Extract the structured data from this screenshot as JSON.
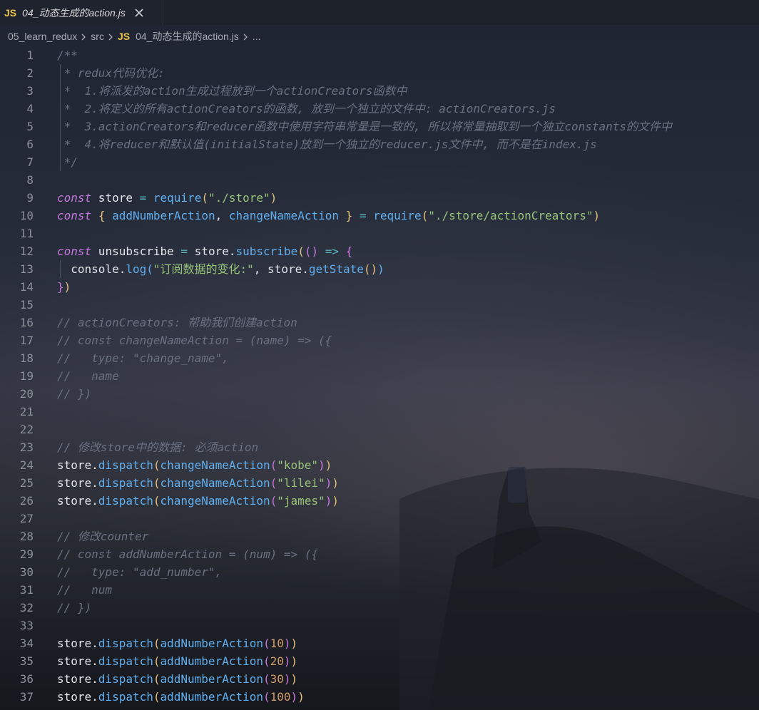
{
  "tab": {
    "badge": "JS",
    "title": "04_动态生成的action.js",
    "close_icon": "close-icon"
  },
  "breadcrumb": {
    "items": [
      "05_learn_redux",
      "src"
    ],
    "file_badge": "JS",
    "file": "04_动态生成的action.js",
    "more": "..."
  },
  "colors": {
    "keyword": "#c678dd",
    "function": "#61afef",
    "string": "#98c379",
    "number": "#d19a66",
    "comment": "#6a7080",
    "bracket_gold": "#e5c07b",
    "js_badge": "#e8c24a"
  },
  "lines": [
    {
      "n": "1",
      "tokens": [
        [
          "com",
          "/**"
        ]
      ]
    },
    {
      "n": "2",
      "tokens": [
        [
          "com",
          " * redux代码优化:"
        ]
      ]
    },
    {
      "n": "3",
      "tokens": [
        [
          "com",
          " *  1.将派发的action生成过程放到一个actionCreators函数中"
        ]
      ]
    },
    {
      "n": "4",
      "tokens": [
        [
          "com",
          " *  2.将定义的所有actionCreators的函数, 放到一个独立的文件中: actionCreators.js"
        ]
      ]
    },
    {
      "n": "5",
      "tokens": [
        [
          "com",
          " *  3.actionCreators和reducer函数中使用字符串常量是一致的, 所以将常量抽取到一个独立constants的文件中"
        ]
      ]
    },
    {
      "n": "6",
      "tokens": [
        [
          "com",
          " *  4.将reducer和默认值(initialState)放到一个独立的reducer.js文件中, 而不是在index.js"
        ]
      ]
    },
    {
      "n": "7",
      "tokens": [
        [
          "com",
          " */"
        ]
      ]
    },
    {
      "n": "8",
      "tokens": []
    },
    {
      "n": "9",
      "tokens": [
        [
          "kw",
          "const"
        ],
        [
          "var",
          " store "
        ],
        [
          "op",
          "="
        ],
        [
          "plain",
          " "
        ],
        [
          "fn",
          "require"
        ],
        [
          "p1",
          "("
        ],
        [
          "str",
          "\"./store\""
        ],
        [
          "p1",
          ")"
        ]
      ]
    },
    {
      "n": "10",
      "tokens": [
        [
          "kw",
          "const"
        ],
        [
          "plain",
          " "
        ],
        [
          "p1",
          "{"
        ],
        [
          "plain",
          " "
        ],
        [
          "fn",
          "addNumberAction"
        ],
        [
          "plain",
          ", "
        ],
        [
          "fn",
          "changeNameAction"
        ],
        [
          "plain",
          " "
        ],
        [
          "p1",
          "}"
        ],
        [
          "plain",
          " "
        ],
        [
          "op",
          "="
        ],
        [
          "plain",
          " "
        ],
        [
          "fn",
          "require"
        ],
        [
          "p1",
          "("
        ],
        [
          "str",
          "\"./store/actionCreators\""
        ],
        [
          "p1",
          ")"
        ]
      ]
    },
    {
      "n": "11",
      "tokens": []
    },
    {
      "n": "12",
      "tokens": [
        [
          "kw",
          "const"
        ],
        [
          "var",
          " unsubscribe "
        ],
        [
          "op",
          "="
        ],
        [
          "plain",
          " store."
        ],
        [
          "fn",
          "subscribe"
        ],
        [
          "p1",
          "("
        ],
        [
          "p2",
          "()"
        ],
        [
          "plain",
          " "
        ],
        [
          "op",
          "=>"
        ],
        [
          "plain",
          " "
        ],
        [
          "p2",
          "{"
        ]
      ]
    },
    {
      "n": "13",
      "tokens": [
        [
          "plain",
          "  console."
        ],
        [
          "fn",
          "log"
        ],
        [
          "p3",
          "("
        ],
        [
          "str",
          "\"订阅数据的变化:\""
        ],
        [
          "plain",
          ", store."
        ],
        [
          "fn",
          "getState"
        ],
        [
          "p1",
          "()"
        ],
        [
          "p3",
          ")"
        ]
      ]
    },
    {
      "n": "14",
      "tokens": [
        [
          "p2",
          "}"
        ],
        [
          "p1",
          ")"
        ]
      ]
    },
    {
      "n": "15",
      "tokens": []
    },
    {
      "n": "16",
      "tokens": [
        [
          "com",
          "// actionCreators: 帮助我们创建action"
        ]
      ]
    },
    {
      "n": "17",
      "tokens": [
        [
          "com",
          "// const changeNameAction = (name) => ({"
        ]
      ]
    },
    {
      "n": "18",
      "tokens": [
        [
          "com",
          "//   type: \"change_name\","
        ]
      ]
    },
    {
      "n": "19",
      "tokens": [
        [
          "com",
          "//   name"
        ]
      ]
    },
    {
      "n": "20",
      "tokens": [
        [
          "com",
          "// })"
        ]
      ]
    },
    {
      "n": "21",
      "tokens": []
    },
    {
      "n": "22",
      "tokens": []
    },
    {
      "n": "23",
      "tokens": [
        [
          "com",
          "// 修改store中的数据: 必须action"
        ]
      ]
    },
    {
      "n": "24",
      "tokens": [
        [
          "plain",
          "store."
        ],
        [
          "fn",
          "dispatch"
        ],
        [
          "p1",
          "("
        ],
        [
          "fn",
          "changeNameAction"
        ],
        [
          "p2",
          "("
        ],
        [
          "str",
          "\"kobe\""
        ],
        [
          "p2",
          ")"
        ],
        [
          "p1",
          ")"
        ]
      ]
    },
    {
      "n": "25",
      "tokens": [
        [
          "plain",
          "store."
        ],
        [
          "fn",
          "dispatch"
        ],
        [
          "p1",
          "("
        ],
        [
          "fn",
          "changeNameAction"
        ],
        [
          "p2",
          "("
        ],
        [
          "str",
          "\"lilei\""
        ],
        [
          "p2",
          ")"
        ],
        [
          "p1",
          ")"
        ]
      ]
    },
    {
      "n": "26",
      "tokens": [
        [
          "plain",
          "store."
        ],
        [
          "fn",
          "dispatch"
        ],
        [
          "p1",
          "("
        ],
        [
          "fn",
          "changeNameAction"
        ],
        [
          "p2",
          "("
        ],
        [
          "str",
          "\"james\""
        ],
        [
          "p2",
          ")"
        ],
        [
          "p1",
          ")"
        ]
      ]
    },
    {
      "n": "27",
      "tokens": []
    },
    {
      "n": "28",
      "tokens": [
        [
          "com",
          "// 修改counter"
        ]
      ]
    },
    {
      "n": "29",
      "tokens": [
        [
          "com",
          "// const addNumberAction = (num) => ({"
        ]
      ]
    },
    {
      "n": "30",
      "tokens": [
        [
          "com",
          "//   type: \"add_number\","
        ]
      ]
    },
    {
      "n": "31",
      "tokens": [
        [
          "com",
          "//   num"
        ]
      ]
    },
    {
      "n": "32",
      "tokens": [
        [
          "com",
          "// })"
        ]
      ]
    },
    {
      "n": "33",
      "tokens": []
    },
    {
      "n": "34",
      "tokens": [
        [
          "plain",
          "store."
        ],
        [
          "fn",
          "dispatch"
        ],
        [
          "p1",
          "("
        ],
        [
          "fn",
          "addNumberAction"
        ],
        [
          "p2",
          "("
        ],
        [
          "num",
          "10"
        ],
        [
          "p2",
          ")"
        ],
        [
          "p1",
          ")"
        ]
      ]
    },
    {
      "n": "35",
      "tokens": [
        [
          "plain",
          "store."
        ],
        [
          "fn",
          "dispatch"
        ],
        [
          "p1",
          "("
        ],
        [
          "fn",
          "addNumberAction"
        ],
        [
          "p2",
          "("
        ],
        [
          "num",
          "20"
        ],
        [
          "p2",
          ")"
        ],
        [
          "p1",
          ")"
        ]
      ]
    },
    {
      "n": "36",
      "tokens": [
        [
          "plain",
          "store."
        ],
        [
          "fn",
          "dispatch"
        ],
        [
          "p1",
          "("
        ],
        [
          "fn",
          "addNumberAction"
        ],
        [
          "p2",
          "("
        ],
        [
          "num",
          "30"
        ],
        [
          "p2",
          ")"
        ],
        [
          "p1",
          ")"
        ]
      ]
    },
    {
      "n": "37",
      "tokens": [
        [
          "plain",
          "store."
        ],
        [
          "fn",
          "dispatch"
        ],
        [
          "p1",
          "("
        ],
        [
          "fn",
          "addNumberAction"
        ],
        [
          "p2",
          "("
        ],
        [
          "num",
          "100"
        ],
        [
          "p2",
          ")"
        ],
        [
          "p1",
          ")"
        ]
      ]
    }
  ]
}
